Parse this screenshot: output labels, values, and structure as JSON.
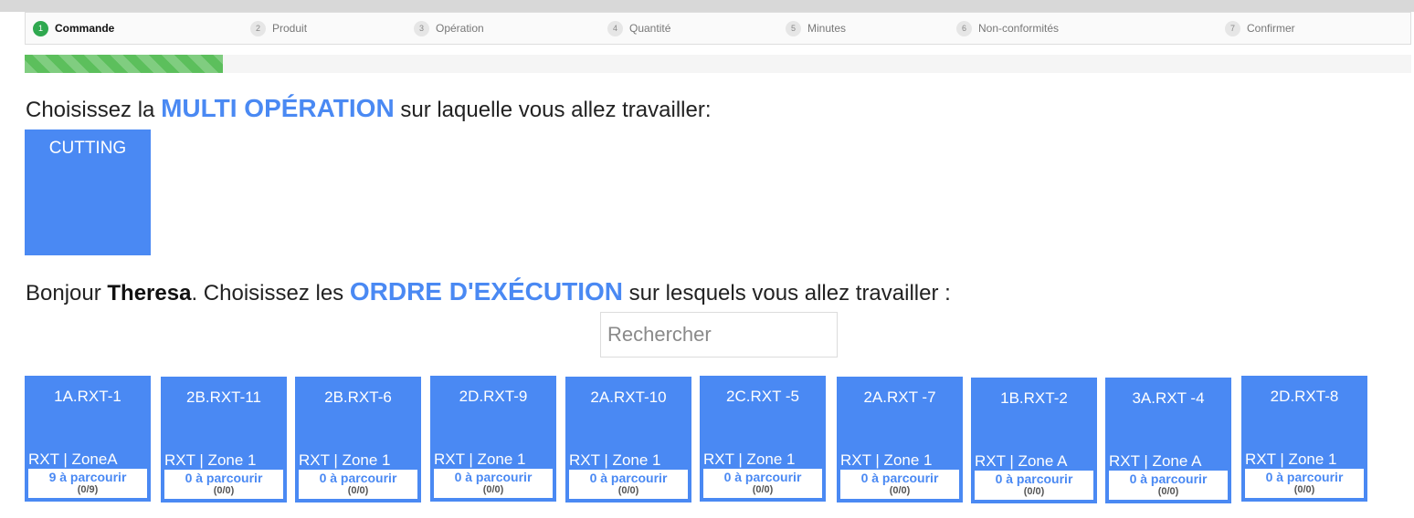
{
  "steps": [
    {
      "num": "1",
      "label": "Commande"
    },
    {
      "num": "2",
      "label": "Produit"
    },
    {
      "num": "3",
      "label": "Opération"
    },
    {
      "num": "4",
      "label": "Quantité"
    },
    {
      "num": "5",
      "label": "Minutes"
    },
    {
      "num": "6",
      "label": "Non-conformités"
    },
    {
      "num": "7",
      "label": "Confirmer"
    }
  ],
  "active_step": 1,
  "progress": {
    "fraction": 0.143,
    "color": "#5cbf5c"
  },
  "colors": {
    "accent": "#4a89f3",
    "active_step": "#2fa84f"
  },
  "multi_operation": {
    "prefix": "Choisissez la ",
    "highlight": "MULTI OPÉRATION",
    "suffix": " sur laquelle vous allez travailler:",
    "tiles": [
      {
        "label": "CUTTING"
      }
    ]
  },
  "execution": {
    "greeting": "Bonjour ",
    "user": "Theresa",
    "middle": ". Choisissez les ",
    "highlight": "ORDRE D'EXÉCUTION",
    "suffix": " sur lesquels vous allez travailler :",
    "search_placeholder": "Rechercher",
    "orders": [
      {
        "code": "1A.RXT-1",
        "zone": "RXT | ZoneA",
        "count": "9 à parcourir",
        "ratio": "(0/9)"
      },
      {
        "code": "2B.RXT-11",
        "zone": "RXT | Zone 1",
        "count": "0 à parcourir",
        "ratio": "(0/0)"
      },
      {
        "code": "2B.RXT-6",
        "zone": "RXT | Zone 1",
        "count": "0 à parcourir",
        "ratio": "(0/0)"
      },
      {
        "code": "2D.RXT-9",
        "zone": "RXT | Zone 1",
        "count": "0 à parcourir",
        "ratio": "(0/0)"
      },
      {
        "code": "2A.RXT-10",
        "zone": "RXT | Zone 1",
        "count": "0 à parcourir",
        "ratio": "(0/0)"
      },
      {
        "code": "2C.RXT -5",
        "zone": "RXT | Zone 1",
        "count": "0 à parcourir",
        "ratio": "(0/0)"
      },
      {
        "code": "2A.RXT -7",
        "zone": "RXT | Zone 1",
        "count": "0 à parcourir",
        "ratio": "(0/0)"
      },
      {
        "code": "1B.RXT-2",
        "zone": "RXT | Zone A",
        "count": "0 à parcourir",
        "ratio": "(0/0)"
      },
      {
        "code": "3A.RXT -4",
        "zone": "RXT | Zone A",
        "count": "0 à parcourir",
        "ratio": "(0/0)"
      },
      {
        "code": "2D.RXT-8",
        "zone": "RXT | Zone 1",
        "count": "0 à parcourir",
        "ratio": "(0/0)"
      }
    ]
  }
}
